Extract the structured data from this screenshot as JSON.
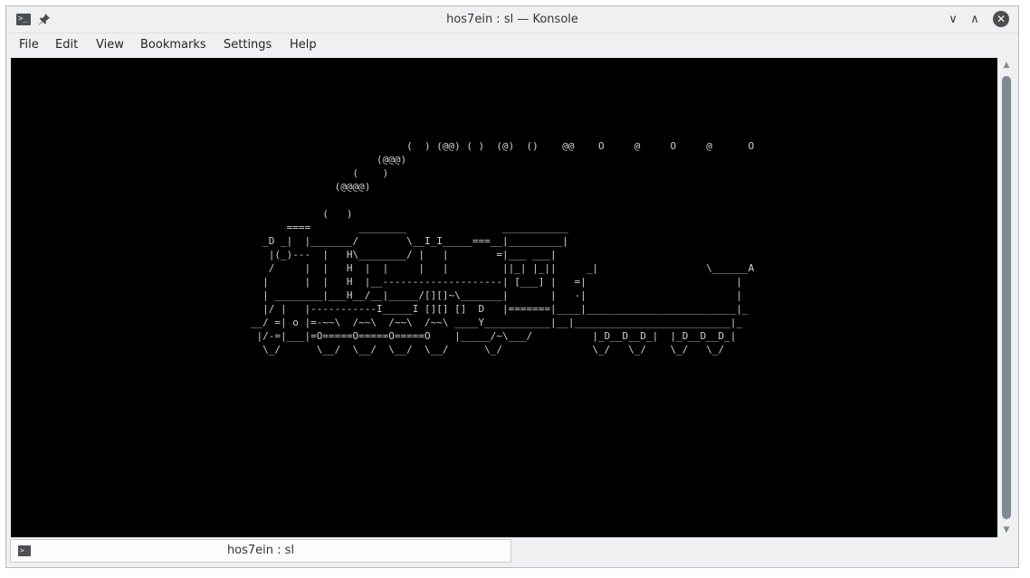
{
  "window": {
    "title": "hos7ein : sl — Konsole",
    "icons": {
      "app": "terminal-icon",
      "pin": "pin-icon"
    },
    "controls": {
      "minimize": "∨",
      "maximize": "∧",
      "close": "✕"
    }
  },
  "menubar": {
    "items": [
      {
        "label": "File"
      },
      {
        "label": "Edit"
      },
      {
        "label": "View"
      },
      {
        "label": "Bookmarks"
      },
      {
        "label": "Settings"
      },
      {
        "label": "Help"
      }
    ]
  },
  "terminal": {
    "background": "#000000",
    "foreground": "#d0d0d0",
    "lines": [
      "",
      "",
      "",
      "",
      "",
      "",
      "                                                                  (  ) (@@) ( )  (@)  ()    @@    O     @     O     @      O",
      "                                                             (@@@)",
      "                                                         (    )",
      "                                                      (@@@@)",
      "",
      "                                                    (   )",
      "                                              ====        ________                ___________",
      "                                          _D _|  |_______/        \\__I_I_____===__|_________|",
      "                                           |(_)---  |   H\\________/ |   |        =|___ ___|",
      "                                           /     |  |   H  |  |     |   |         ||_| |_||     _|                  \\______A",
      "                                          |      |  |   H  |__--------------------| [___] |   =|                         |",
      "                                          | ________|___H__/__|_____/[][]~\\_______|       |   -|                         |",
      "                                          |/ |   |-----------I_____I [][] []  D   |=======|____|_________________________|_",
      "                                        __/ =| o |=-~~\\  /~~\\  /~~\\  /~~\\ ____Y___________|__|__________________________|_",
      "                                         |/-=|___|=O=====O=====O=====O    |_____/~\\___/          |_D__D__D_|  |_D__D__D_|",
      "                                          \\_/      \\__/  \\__/  \\__/  \\__/      \\_/               \\_/   \\_/    \\_/   \\_/"
    ]
  },
  "scrollbar": {
    "up": "▲",
    "down": "▼"
  },
  "tab": {
    "label": "hos7ein : sl",
    "icon": "terminal-icon"
  }
}
